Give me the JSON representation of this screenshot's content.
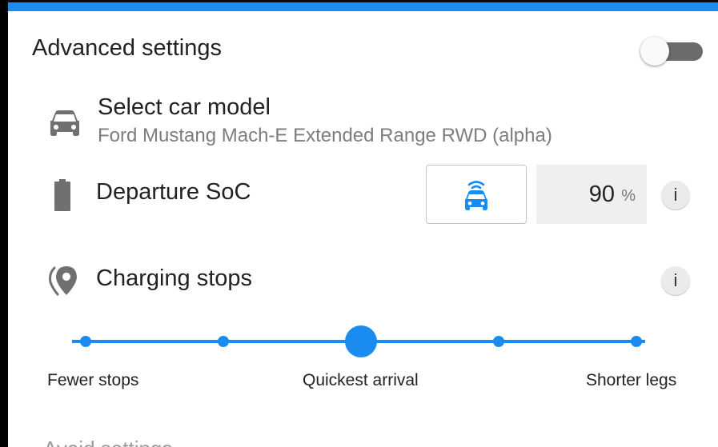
{
  "panel": {
    "accent_color": "#1a8cf0",
    "title": "Advanced settings",
    "toggle": {
      "state": "off"
    }
  },
  "car_model": {
    "label": "Select car model",
    "value": "Ford Mustang Mach-E Extended Range RWD (alpha)",
    "icon": "car-icon"
  },
  "departure_soc": {
    "label": "Departure SoC",
    "icon": "battery-icon",
    "mode_icon": "connected-car-icon",
    "value": "90",
    "unit": "%",
    "info": "i"
  },
  "charging_stops": {
    "label": "Charging stops",
    "icon": "location-pin-icon",
    "info": "i",
    "slider": {
      "steps": 5,
      "selected_index": 2,
      "labels": {
        "left": "Fewer stops",
        "center": "Quickest arrival",
        "right": "Shorter legs"
      }
    }
  },
  "next_section": {
    "label": "Avoid settings",
    "state": "clipped"
  }
}
